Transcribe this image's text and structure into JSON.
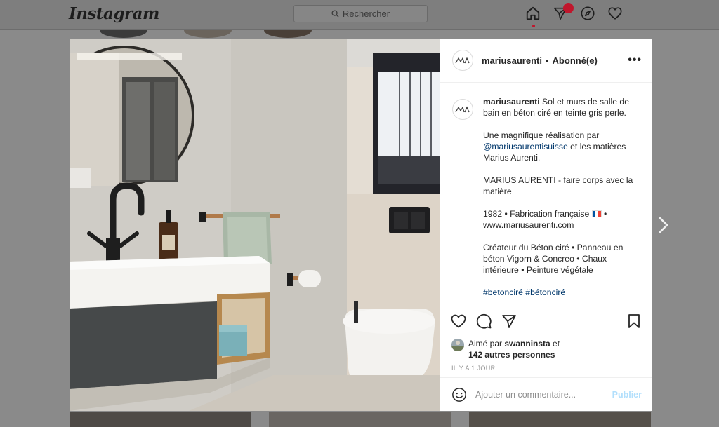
{
  "app": {
    "logo_text": "Instagram",
    "search_placeholder": "Rechercher"
  },
  "nav_icons": [
    "home-icon",
    "direct-icon",
    "explore-icon",
    "activity-icon"
  ],
  "post": {
    "username": "mariusaurenti",
    "follow_status": "Abonné(e)",
    "separator": "•",
    "more_label": "•••",
    "caption": {
      "username": "mariusaurenti",
      "p1": "Sol et murs de salle de bain en béton ciré en teinte gris perle.",
      "p2_pre": "Une magnifique réalisation par ",
      "p2_link": "@mariusaurentisuisse",
      "p2_post": " et les matières Marius Aurenti.",
      "p3": "MARIUS AURENTI - faire corps avec la matière",
      "p4_pre": "1982 • Fabrication française ",
      "p4_post": " • www.mariusaurenti.com",
      "p5": "Créateur du Béton ciré • Panneau en béton Vigorn & Concreo • Chaux intérieure • Peinture végétale",
      "hashtags": "#betonciré #bétonciré"
    },
    "likes": {
      "prefix": "Aimé par ",
      "user": "swanninsta",
      "middle": " et",
      "others": "142 autres personnes"
    },
    "timestamp": "IL Y A 1 JOUR",
    "comment_placeholder": "Ajouter un commentaire...",
    "publish_label": "Publier"
  },
  "colors": {
    "link": "#00376b",
    "publish_disabled": "#b2dffc",
    "notification": "#c0162c"
  }
}
